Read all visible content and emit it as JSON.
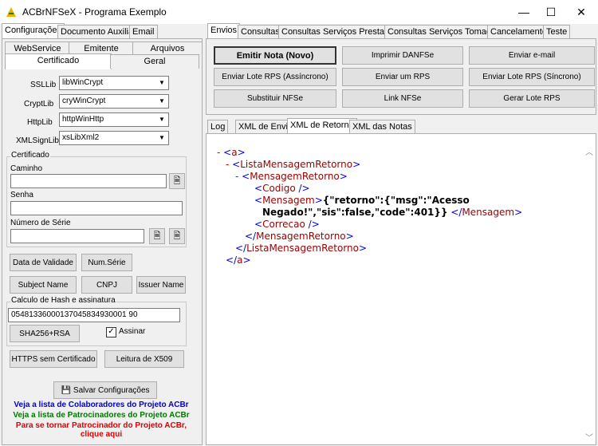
{
  "window": {
    "title": "ACBrNFSeX - Programa Exemplo",
    "minimize": "—",
    "maximize": "☐",
    "close": "✕"
  },
  "left_tabs": {
    "row1": [
      "Configurações",
      "Documento Auxiliar",
      "Email"
    ],
    "row2": [
      "WebService",
      "Emitente",
      "Arquivos"
    ],
    "row3": [
      "Certificado",
      "Geral"
    ]
  },
  "certificado": {
    "ssllib_label": "SSLLib",
    "ssllib_value": "libWinCrypt",
    "cryptlib_label": "CryptLib",
    "cryptlib_value": "cryWinCrypt",
    "httplib_label": "HttpLib",
    "httplib_value": "httpWinHttp",
    "xmlsignlib_label": "XMLSignLib",
    "xmlsignlib_value": "xsLibXml2",
    "group_title": "Certificado",
    "caminho_label": "Caminho",
    "caminho_value": "",
    "senha_label": "Senha",
    "senha_value": "",
    "numserie_label": "Número de Série",
    "numserie_value": "",
    "btn_validade": "Data de Validade",
    "btn_numserie": "Num.Série",
    "btn_subject": "Subject Name",
    "btn_cnpj": "CNPJ",
    "btn_issuer": "Issuer Name",
    "hash_group_title": "Calculo de Hash e assinatura",
    "hash_value": "05481336000137045834930001 90",
    "btn_sha": "SHA256+RSA",
    "assinar_label": "Assinar",
    "assinar_checked": "✓",
    "btn_https": "HTTPS sem Certificado",
    "btn_x509": "Leitura de X509"
  },
  "save_button": "Salvar Configurações",
  "links": {
    "colab": "Veja a lista de Colaboradores do Projeto ACBr",
    "patro": "Veja a lista de Patrocinadores do Projeto ACBr",
    "tornar1": "Para se tornar Patrocinador do Projeto ACBr,",
    "tornar2": "clique aqui"
  },
  "right_tabs": [
    "Envios",
    "Consultas",
    "Consultas Serviços Prestados",
    "Consultas Serviços Tomados",
    "Cancelamento",
    "Teste"
  ],
  "envios_buttons": {
    "emitir": "Emitir Nota (Novo)",
    "imprimir": "Imprimir DANFSe",
    "email": "Enviar e-mail",
    "lote_assinc": "Enviar Lote RPS (Assíncrono)",
    "um_rps": "Enviar um RPS",
    "lote_sinc": "Enviar Lote RPS (Síncrono)",
    "substituir": "Substituir NFSe",
    "link": "Link NFSe",
    "gerar": "Gerar Lote RPS"
  },
  "bottom_tabs": [
    "Log",
    "XML de Envio",
    "XML de Retorno",
    "XML das Notas"
  ],
  "xml": {
    "minus": "-",
    "a": "a",
    "lista": "ListaMensagemRetorno",
    "msg": "MensagemRetorno",
    "codigo": "Codigo",
    "mensagem": "Mensagem",
    "correcao": "Correcao",
    "text1": "{\"retorno\":{\"msg\":\"Acesso",
    "text2": "Negado!\",\"sis\":false,\"code\":401}}"
  }
}
